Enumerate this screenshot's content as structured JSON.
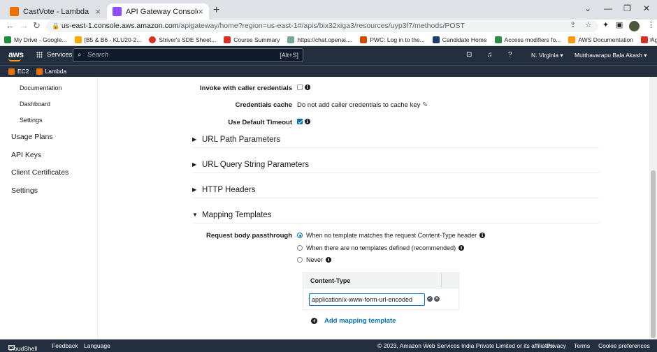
{
  "browser": {
    "tabs": [
      {
        "title": "CastVote - Lambda",
        "close": "×",
        "active": false,
        "color": "#ed7100"
      },
      {
        "title": "API Gateway Console",
        "close": "×",
        "active": true,
        "color": "#8c4fff"
      }
    ],
    "new_tab": "+",
    "window_controls": {
      "dropdown": "⌄",
      "minimize": "—",
      "maximize": "❐",
      "close": "✕"
    },
    "nav": {
      "back": "←",
      "forward": "→",
      "reload": "↻"
    },
    "url_host": "us-east-1.console.aws.amazon.com",
    "url_path": "/apigateway/home?region=us-east-1#/apis/bix32xiga3/resources/uyp3f7/methods/POST",
    "bookmarks": [
      {
        "label": "My Drive - Google...",
        "color": "#1e8e3e"
      },
      {
        "label": "[B5 & B6 - KLU20-2...",
        "color": "#f9ab00"
      },
      {
        "label": "Striver's SDE Sheet...",
        "color": "#d93025"
      },
      {
        "label": "Course Summary",
        "color": "#d93025"
      },
      {
        "label": "https://chat.openai....",
        "color": "#74aa9c"
      },
      {
        "label": "PWC: Log in to the...",
        "color": "#d04a02"
      },
      {
        "label": "Candidate Home",
        "color": "#1a3e72"
      },
      {
        "label": "Access modifiers fo...",
        "color": "#2f8d46"
      },
      {
        "label": "AWS Documentation",
        "color": "#ff9900"
      },
      {
        "label": "Aggregation in Java...",
        "color": "#d93025"
      }
    ],
    "bookmarks_more": "»"
  },
  "aws_header": {
    "logo": "aws",
    "services": "Services",
    "search_placeholder": "Search",
    "search_shortcut": "[Alt+S]",
    "region": "N. Virginia ▾",
    "user": "Mutthavarapu Bala Akash ▾",
    "favorites": [
      {
        "label": "EC2"
      },
      {
        "label": "Lambda"
      }
    ]
  },
  "sidebar": {
    "sub_items": [
      "Documentation",
      "Dashboard",
      "Settings"
    ],
    "top_items": [
      "Usage Plans",
      "API Keys",
      "Client Certificates",
      "Settings"
    ]
  },
  "form": {
    "invoke_label": "Invoke with caller credentials",
    "cred_cache_label": "Credentials cache",
    "cred_cache_value": "Do not add caller credentials to cache key",
    "default_timeout_label": "Use Default Timeout"
  },
  "sections": {
    "url_path": "URL Path Parameters",
    "url_query": "URL Query String Parameters",
    "http_headers": "HTTP Headers",
    "mapping_templates": "Mapping Templates"
  },
  "mapping": {
    "passthrough_label": "Request body passthrough",
    "options": [
      "When no template matches the request Content-Type header",
      "When there are no templates defined (recommended)",
      "Never"
    ],
    "content_type_header": "Content-Type",
    "content_type_value": "application/x-www-form-url-encoded",
    "add_template": "Add mapping template"
  },
  "footer": {
    "cloudshell": "CloudShell",
    "feedback": "Feedback",
    "language": "Language",
    "copyright": "© 2023, Amazon Web Services India Private Limited or its affiliates.",
    "privacy": "Privacy",
    "terms": "Terms",
    "cookies": "Cookie preferences"
  }
}
